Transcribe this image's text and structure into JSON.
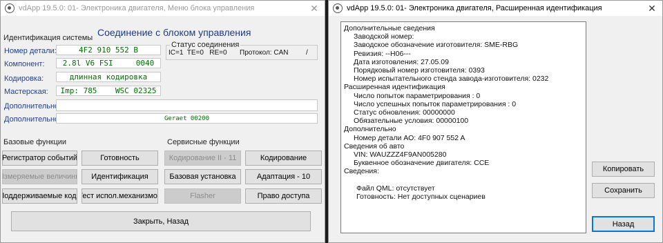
{
  "left_window": {
    "title": "vdApp 19.5.0: 01- Электроника двигателя,  Меню блока управления",
    "connection_title": "Соединение с блоком управления",
    "system_ident_label": "Идентификация системы",
    "fields": [
      {
        "label": "Номер детали:",
        "value": "4F2 910 552 B"
      },
      {
        "label": "Компонент:",
        "value": "2.8l V6 FSI     0040"
      },
      {
        "label": "Кодировка:",
        "value": "длинная кодировка"
      },
      {
        "label": "Мастерская:",
        "value": "Imp: 785    WSC 02325"
      },
      {
        "label": "Дополнительно:",
        "value": ""
      },
      {
        "label": "Дополнительно:",
        "value": "Geraet 00200"
      }
    ],
    "status": {
      "title": "Статус соединения",
      "line": "IC=1  TE=0   RE=0",
      "protocol": "Протокол: CAN",
      "slash": "/"
    },
    "basic_functions": {
      "label": "Базовые функции",
      "buttons": [
        {
          "label": "Регистратор событий"
        },
        {
          "label": "Готовность"
        },
        {
          "label": "Измеряемые величины"
        },
        {
          "label": "Идентификация"
        },
        {
          "label": "Поддерживаемые кода"
        },
        {
          "label": "Тест испол.механизмов"
        }
      ]
    },
    "service_functions": {
      "label": "Сервисные функции",
      "buttons": [
        {
          "label": "Кодирование II - 11"
        },
        {
          "label": "Кодирование"
        },
        {
          "label": "Базовая установка"
        },
        {
          "label": "Адаптация - 10"
        },
        {
          "label": "Flasher"
        },
        {
          "label": "Право доступа"
        }
      ]
    },
    "close_button": "Закрыть, Назад"
  },
  "right_window": {
    "title": "vdApp 19.5.0: 01- Электроника двигателя,  Расширенная идентификация",
    "lines": [
      {
        "text": "Дополнительные сведения",
        "indent": 0
      },
      {
        "text": "Заводской номер:",
        "indent": 1
      },
      {
        "text": "Заводское обозначение изготовителя: SME-RBG",
        "indent": 1
      },
      {
        "text": "Ревизия: --H06---",
        "indent": 1
      },
      {
        "text": "Дата изготовления: 27.05.09",
        "indent": 1
      },
      {
        "text": "Порядковый номер изготовителя: 0393",
        "indent": 1
      },
      {
        "text": "Номер испытательного стенда завода-изготовителя: 0232",
        "indent": 1
      },
      {
        "text": "Расширенная идентификация",
        "indent": 0
      },
      {
        "text": "Число попыток параметрирования : 0",
        "indent": 1
      },
      {
        "text": "Число успешных попыток параметрирования : 0",
        "indent": 1
      },
      {
        "text": "Статус обновления: 00000000",
        "indent": 1
      },
      {
        "text": "Обязательные условия: 00000100",
        "indent": 1
      },
      {
        "text": "Дополнительно",
        "indent": 0
      },
      {
        "text": "Номер детали АО: 4F0 907 552 A",
        "indent": 1
      },
      {
        "text": "Сведения об авто",
        "indent": 0
      },
      {
        "text": "VIN: WAUZZZ4F9AN005280",
        "indent": 1
      },
      {
        "text": "Буквенное обозначение двигателя: CCE",
        "indent": 1
      },
      {
        "text": "Сведения:",
        "indent": 0
      },
      {
        "text": "",
        "indent": 0
      },
      {
        "text": "Файл QML: отсутствует",
        "indent": 2
      },
      {
        "text": "Готовность: Нет доступных сценариев",
        "indent": 2
      }
    ],
    "copy_button": "Копировать",
    "save_button": "Сохранить",
    "back_button": "Назад"
  }
}
